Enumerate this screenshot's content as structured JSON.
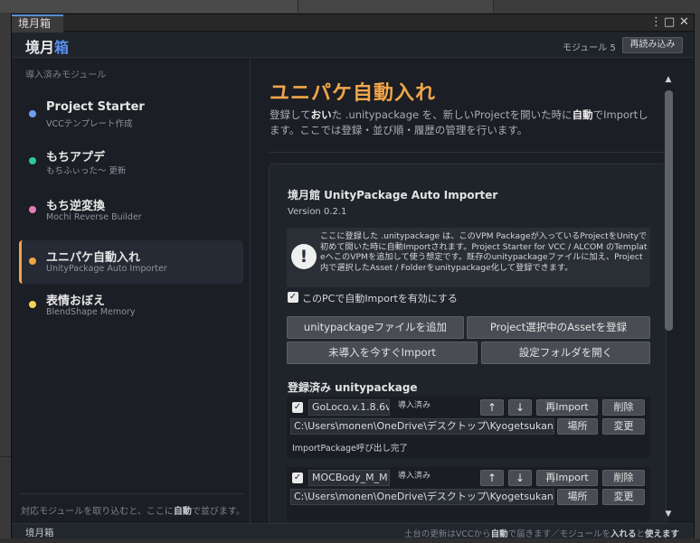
{
  "window": {
    "tab_label": "境月箱",
    "brand_main": "境月",
    "brand_accent": "箱",
    "module_count": "モジュール 5",
    "reload_button": "再読み込み"
  },
  "sidebar": {
    "heading": "導入済みモジュール",
    "items": [
      {
        "title": "Project Starter",
        "subtitle": "VCCテンプレート作成",
        "dot_color": "#6e9df0"
      },
      {
        "title": "もちアプデ",
        "subtitle": "もちふぃった〜 更新",
        "dot_color": "#2fc79a"
      },
      {
        "title": "もち逆変換",
        "subtitle": "Mochi Reverse Builder",
        "dot_color": "#e47bb6"
      },
      {
        "title": "ユニパケ自動入れ",
        "subtitle": "UnityPackage Auto Importer",
        "dot_color": "#f0a445"
      },
      {
        "title": "表情おぼえ",
        "subtitle": "BlendShape Memory",
        "dot_color": "#f2d35a"
      }
    ],
    "footer_pre": "対応モジュールを取り込むと、ここに",
    "footer_bold": "自動",
    "footer_post": "で並びます。"
  },
  "main": {
    "title": "ユニパケ自動入れ",
    "desc_1": "登録して",
    "desc_2": "おい",
    "desc_3": "た .unitypackage を、新しいProjectを開いた時に",
    "desc_4": "自動",
    "desc_5": "でImportします。ここでは登録・並び順・履歴の管理を行います。",
    "card": {
      "title": "境月館 UnityPackage Auto Importer",
      "version": "Version 0.2.1",
      "info_icon": "exclamation-icon",
      "info_text": "ここに登録した .unitypackage は、このVPM Packageが入っているProjectをUnityで初めて開いた時に自動Importされます。Project Starter for VCC / ALCOM のTemplateへこのVPMを追加して使う想定です。既存のunitypackageファイルに加え、Project内で選択したAsset / Folderをunitypackage化して登録できます。",
      "auto_import_label": "このPCで自動Importを有効にする",
      "auto_import_checked": true,
      "btn_add_file": "unitypackageファイルを追加",
      "btn_register_asset": "Project選択中のAssetを登録",
      "btn_import_now": "未導入を今すぐImport",
      "btn_open_folder": "設定フォルダを開く",
      "section_title": "登録済み unitypackage",
      "packages": [
        {
          "name": "GoLoco.v.1.8.6v",
          "checked": true,
          "badge": "導入済み",
          "up": "↑",
          "down": "↓",
          "reimport": "再Import",
          "delete": "削除",
          "path": "C:\\Users\\monen\\OneDrive\\デスクトップ\\Kyogetsukan_",
          "locate": "場所",
          "change": "変更",
          "status": "ImportPackage呼び出し完了"
        },
        {
          "name": "MOCBody_M_M",
          "checked": true,
          "badge": "導入済み",
          "up": "↑",
          "down": "↓",
          "reimport": "再Import",
          "delete": "削除",
          "path": "C:\\Users\\monen\\OneDrive\\デスクトップ\\Kyogetsukan_",
          "locate": "場所",
          "change": "変更"
        }
      ]
    }
  },
  "statusbar": {
    "left": "境月箱",
    "right_1": "土台の更新はVCCから",
    "right_2": "自動",
    "right_3": "で届きます／モジュールを",
    "right_4": "入れる",
    "right_5": "と",
    "right_6": "使えます"
  },
  "icons": {
    "menu": "⋮",
    "maximize": "□",
    "close": "✕",
    "scroll_up": "▲",
    "scroll_down": "▼",
    "check": "✓"
  },
  "colors": {
    "accent_orange": "#f2a64a",
    "accent_blue": "#5b8ff0"
  }
}
